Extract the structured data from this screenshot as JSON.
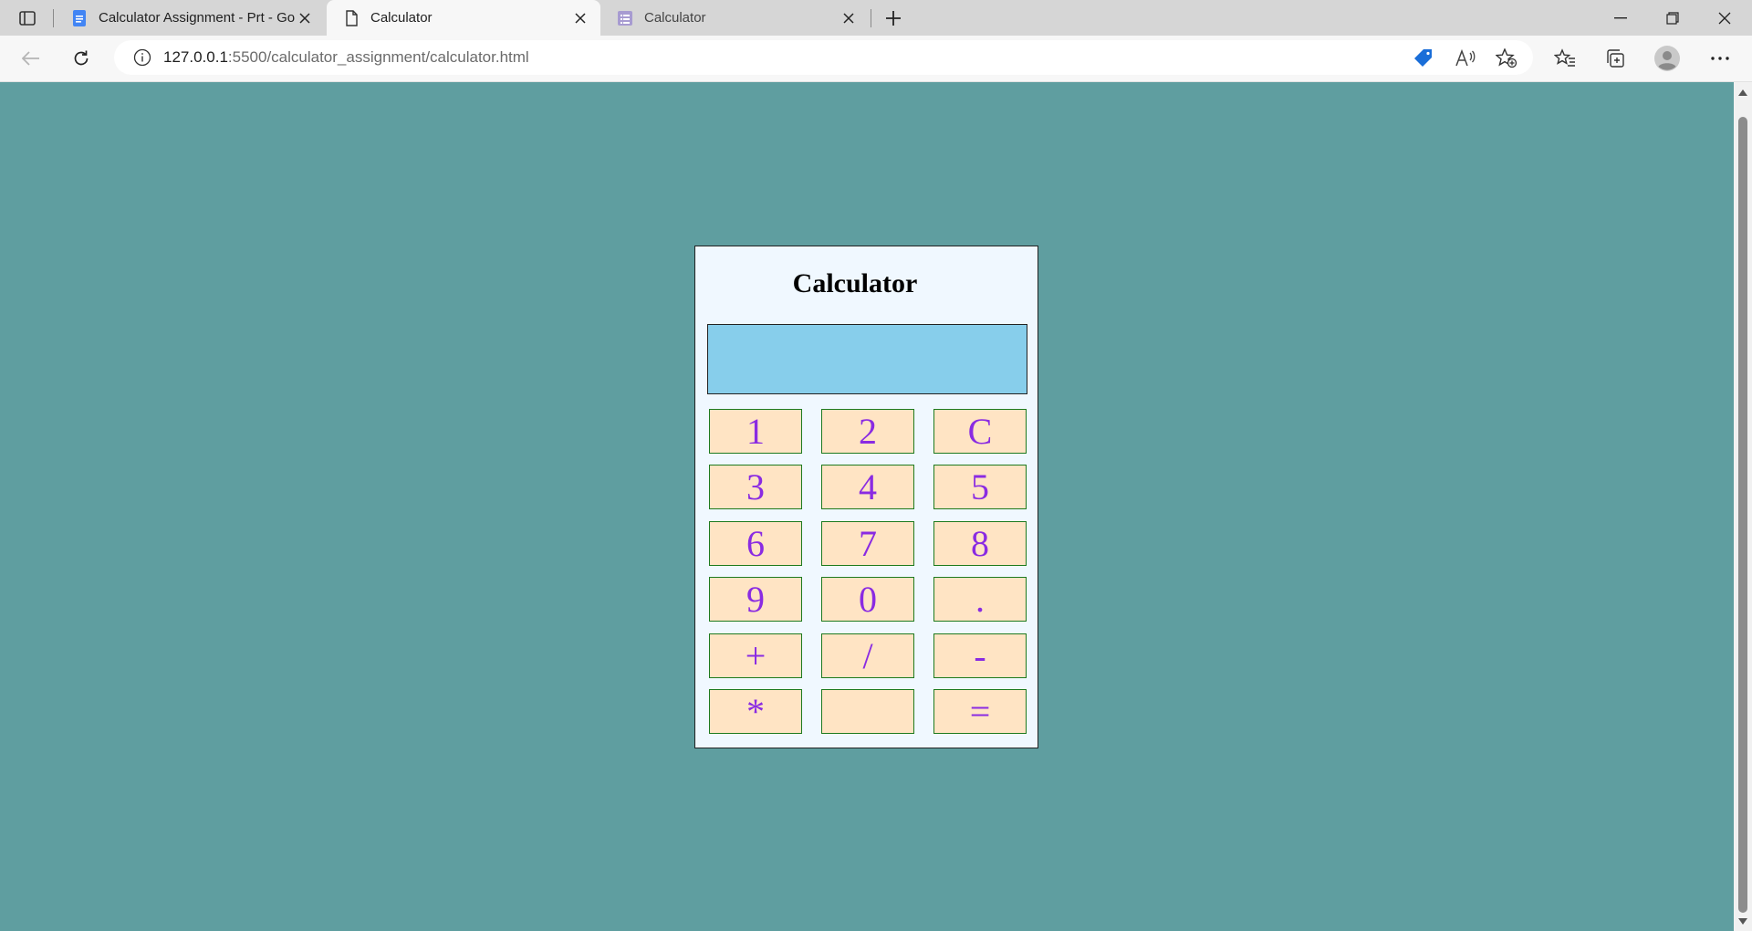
{
  "tabs": [
    {
      "title": "Calculator Assignment - Prt - Go",
      "icon": "google-docs-icon",
      "active": false
    },
    {
      "title": "Calculator",
      "icon": "page-icon",
      "active": true
    },
    {
      "title": "Calculator",
      "icon": "forms-icon",
      "active": false
    }
  ],
  "address_bar": {
    "url_host": "127.0.0.1",
    "url_path": ":5500/calculator_assignment/calculator.html"
  },
  "calculator": {
    "title": "Calculator",
    "display_value": "",
    "keys": [
      "1",
      "2",
      "C",
      "3",
      "4",
      "5",
      "6",
      "7",
      "8",
      "9",
      "0",
      ".",
      "+",
      "/",
      "-",
      "*",
      "",
      "="
    ]
  },
  "colors": {
    "page_background": "#5f9ea0",
    "calculator_background": "#f0f8ff",
    "display_background": "#87ceeb",
    "key_background": "#ffe4c4",
    "key_text": "#8a2be2",
    "key_border": "#1e7a1e"
  }
}
